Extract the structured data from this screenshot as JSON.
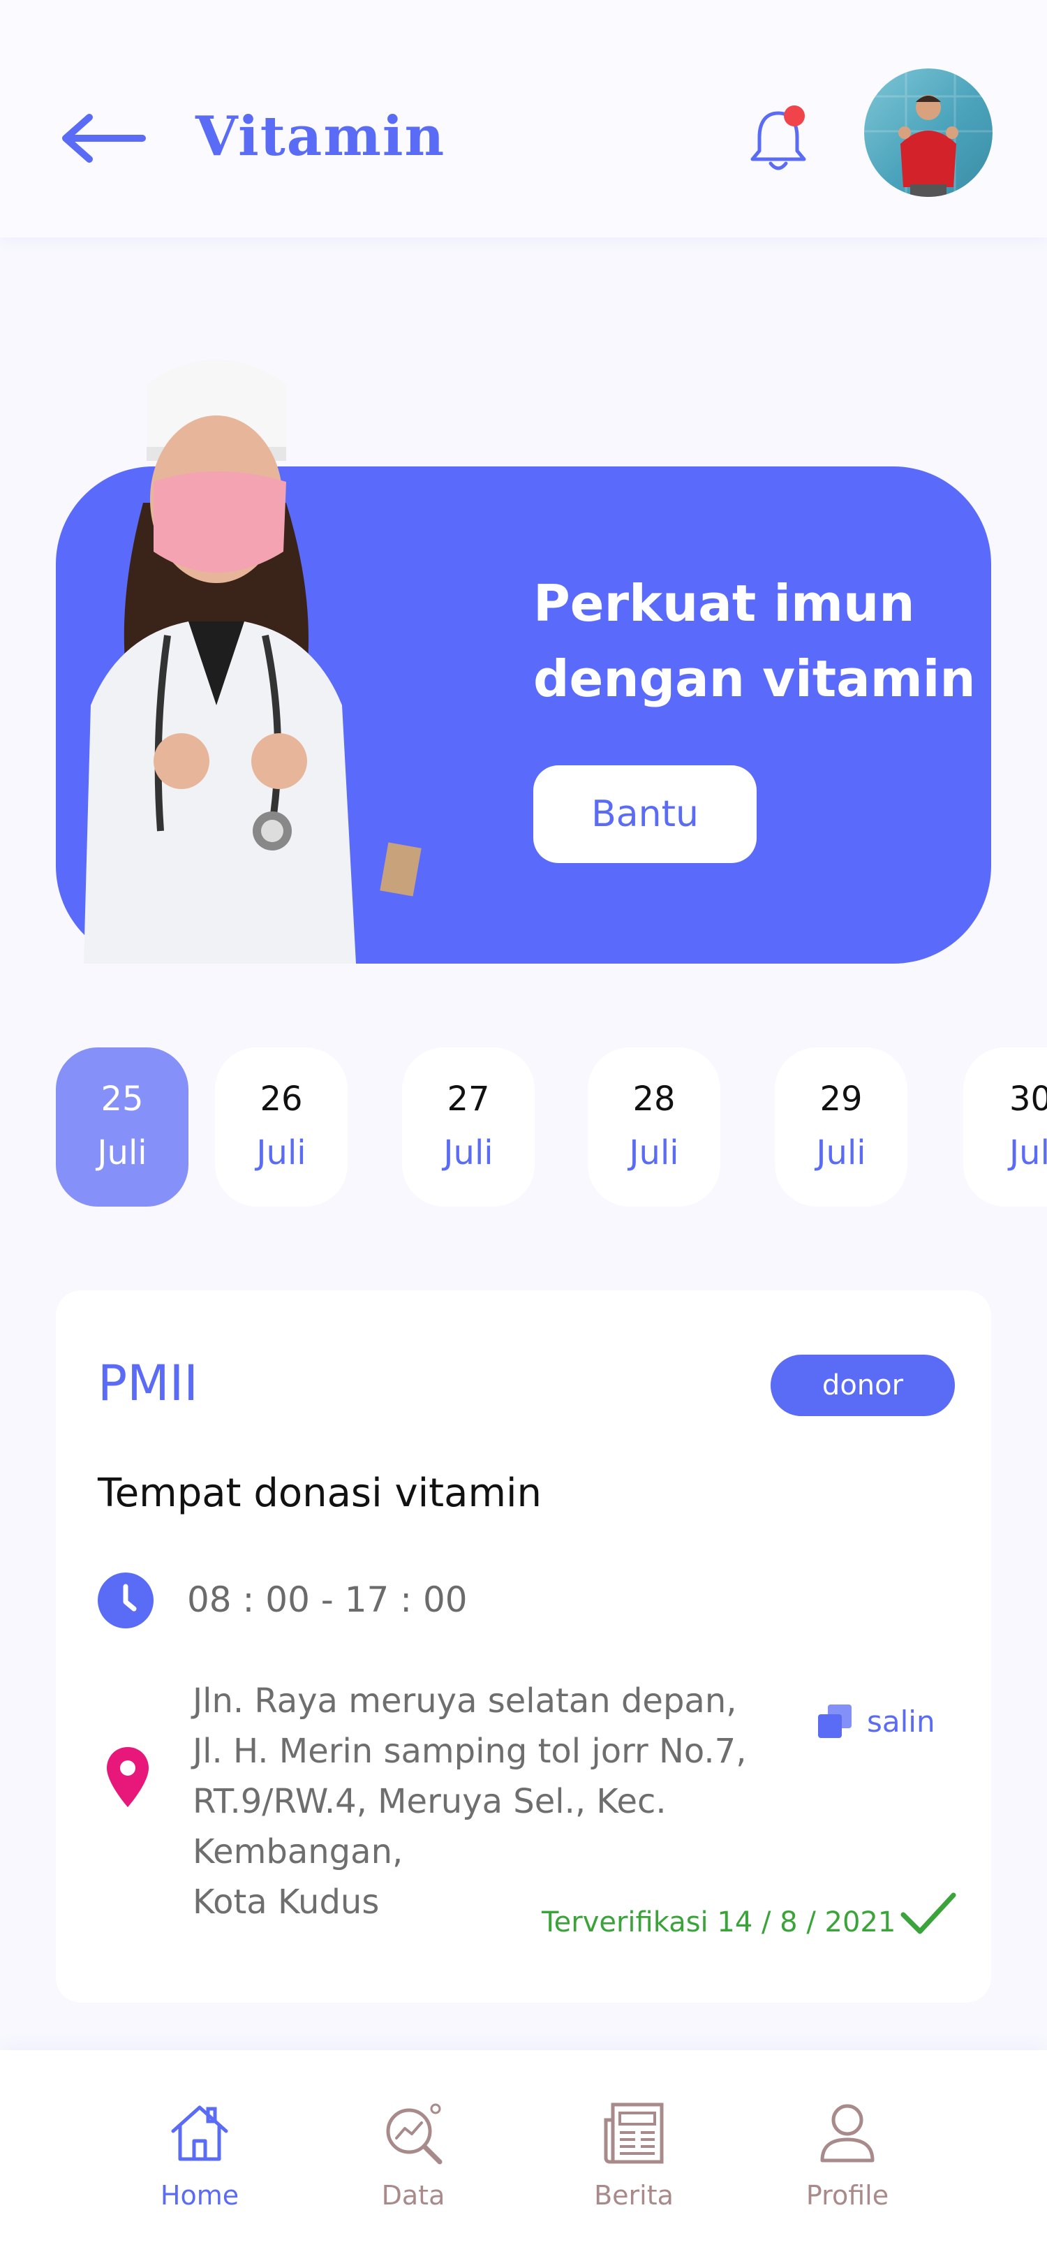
{
  "header": {
    "title": "Vitamin",
    "back_icon": "arrow-left-icon",
    "notification_icon": "bell-icon",
    "has_notification_dot": true
  },
  "banner": {
    "title": "Perkuat imun dengan vitamin",
    "button_label": "Bantu"
  },
  "dates": [
    {
      "day": "25",
      "month": "Juli",
      "active": true
    },
    {
      "day": "26",
      "month": "Juli",
      "active": false
    },
    {
      "day": "27",
      "month": "Juli",
      "active": false
    },
    {
      "day": "28",
      "month": "Juli",
      "active": false
    },
    {
      "day": "29",
      "month": "Juli",
      "active": false
    },
    {
      "day": "30",
      "month": "Juli",
      "active": false
    }
  ],
  "card": {
    "organization": "PMII",
    "tag": "donor",
    "place": "Tempat donasi vitamin",
    "hours": "08 : 00 - 17 : 00",
    "address_lines": [
      "Jln. Raya meruya selatan depan,",
      "Jl. H. Merin samping tol jorr No.7,",
      "RT.9/RW.4, Meruya Sel., Kec. Kembangan,",
      "Kota Kudus"
    ],
    "copy_label": "salin",
    "verified": "Terverifikasi 14 / 8 / 2021"
  },
  "nav": [
    {
      "label": "Home",
      "icon": "home-icon",
      "active": true
    },
    {
      "label": "Data",
      "icon": "data-search-icon",
      "active": false
    },
    {
      "label": "Berita",
      "icon": "newspaper-icon",
      "active": false
    },
    {
      "label": "Profile",
      "icon": "user-icon",
      "active": false
    }
  ],
  "colors": {
    "accent": "#5a6bf5",
    "banner": "#5a6bfb",
    "active_date": "#8591f8",
    "verified": "#3aa339",
    "pin": "#e8177a",
    "notification_dot": "#f0444a"
  }
}
